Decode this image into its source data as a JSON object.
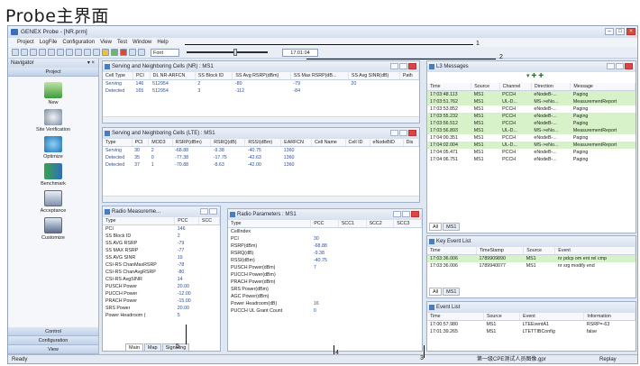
{
  "heading": "Probe主界面",
  "app": {
    "title": "GENEX Probe - [NR.prm]",
    "menu": [
      "Project",
      "LogFile",
      "Configuration",
      "View",
      "Test",
      "Window",
      "Help"
    ],
    "toolbar": {
      "font_value": "Font",
      "time_value": "17:01:04"
    }
  },
  "callouts": [
    "1",
    "2",
    "3",
    "4",
    "5"
  ],
  "navigator": {
    "title": "Navigator",
    "project_button": "Project",
    "items": [
      "New",
      "Site Verification",
      "Optimize",
      "Benchmark",
      "Acceptance",
      "Customize"
    ],
    "bottom_buttons": [
      "Control",
      "Configuration",
      "View"
    ]
  },
  "nr_cells": {
    "title": "Serving and Neighboring Cells (NR) : MS1",
    "headers": [
      "Cell Type",
      "PCI",
      "DL NR-ARFCN",
      "SS Block ID",
      "SS Avg RSRP(dBm)",
      "SS Max RSRP(dB...",
      "SS Avg SINR(dB)",
      "Path"
    ],
    "rows": [
      [
        "Serving",
        "146",
        "512954",
        "2",
        "-80",
        "-79",
        "20",
        ""
      ],
      [
        "Detected",
        "165",
        "512954",
        "3",
        "-112",
        "-84",
        "",
        ""
      ]
    ]
  },
  "lte_cells": {
    "title": "Serving and Neighboring Cells (LTE) : MS1",
    "headers": [
      "Type",
      "PCI",
      "MOD3",
      "RSRP(dBm)",
      "RSRQ(dB)",
      "RSSI(dBm)",
      "EARFCN",
      "Cell Name",
      "Cell ID",
      "eNodeBID",
      "Dis"
    ],
    "rows": [
      [
        "Serving",
        "30",
        "2",
        "-68.88",
        "-9.38",
        "-40.75",
        "1360",
        "",
        "",
        "",
        ""
      ],
      [
        "Detected",
        "35",
        "0",
        "-77.38",
        "-17.75",
        "-42.63",
        "1360",
        "",
        "",
        "",
        ""
      ],
      [
        "Detected",
        "37",
        "1",
        "-70.88",
        "-8.63",
        "-42.00",
        "1360",
        "",
        "",
        "",
        ""
      ]
    ]
  },
  "radio_measure": {
    "title": "Radio Measureme...",
    "headers": [
      "Type",
      "PCC",
      "SCC"
    ],
    "rows": [
      [
        "PCI",
        "146",
        ""
      ],
      [
        "SS Block ID",
        "2",
        ""
      ],
      [
        "SS AVG RSRP",
        "-79",
        ""
      ],
      [
        "SS MAX RSRP",
        "-77",
        ""
      ],
      [
        "SS AVG SINR",
        "19",
        ""
      ],
      [
        "CSI-RS ChanMaxRSRP",
        "-78",
        ""
      ],
      [
        "CSI-RS ChanAvgRSRP",
        "-80",
        ""
      ],
      [
        "CSI-RS AvgSINR",
        "14",
        ""
      ],
      [
        "PUSCH Power",
        "20.00",
        ""
      ],
      [
        "PUCCH Power",
        "-12.00",
        ""
      ],
      [
        "PRACH Power",
        "-15.00",
        ""
      ],
      [
        "SRS Power",
        "20.00",
        ""
      ],
      [
        "Power Headroom (",
        "5",
        ""
      ]
    ]
  },
  "radio_params": {
    "title": "Radio Parameters : MS1",
    "headers": [
      "Type",
      "PCC",
      "SCC1",
      "SCC2",
      "SCC3"
    ],
    "rows": [
      [
        "CellIndex",
        ""
      ],
      [
        "PCI",
        "30"
      ],
      [
        "RSRP(dBm)",
        "-68.88"
      ],
      [
        "RSRQ(dB)",
        "-9.38"
      ],
      [
        "RSSI(dBm)",
        "-40.75"
      ],
      [
        "PUSCH Power(dBm)",
        "7"
      ],
      [
        "PUCCH Power(dBm)",
        ""
      ],
      [
        "PRACH Power(dBm)",
        ""
      ],
      [
        "SRS Power(dBm)",
        ""
      ],
      [
        "AGC Power(dBm)",
        ""
      ],
      [
        "Power Headroom(dB)",
        "16"
      ],
      [
        "PUCCH UL Grant Count",
        "0"
      ]
    ]
  },
  "messages": {
    "title": "L3 Messages",
    "headers": [
      "Time",
      "Source",
      "Channel",
      "Direction",
      "Message"
    ],
    "rows": [
      {
        "v": [
          "17:03:48.113",
          "MS1",
          "PCCH",
          "eNodeB-...",
          "Paging"
        ],
        "hl": true
      },
      {
        "v": [
          "17:03:51.762",
          "MS1",
          "UL-D...",
          "MS->eNo...",
          "MeasurementReport"
        ],
        "hl": true
      },
      {
        "v": [
          "17:03:53.852",
          "MS1",
          "PCCH",
          "eNodeB-...",
          "Paging"
        ],
        "hl": false
      },
      {
        "v": [
          "17:03:55.232",
          "MS1",
          "PCCH",
          "eNodeB-...",
          "Paging"
        ],
        "hl": true
      },
      {
        "v": [
          "17:03:56.512",
          "MS1",
          "PCCH",
          "eNodeB-...",
          "Paging"
        ],
        "hl": true
      },
      {
        "v": [
          "17:03:56.893",
          "MS1",
          "UL-D...",
          "MS->eNo...",
          "MeasurementReport"
        ],
        "hl": true
      },
      {
        "v": [
          "17:04:00.351",
          "MS1",
          "PCCH",
          "eNodeB-...",
          "Paging"
        ],
        "hl": false
      },
      {
        "v": [
          "17:04:02.004",
          "MS1",
          "UL-D...",
          "MS->eNo...",
          "MeasurementReport"
        ],
        "hl": true
      },
      {
        "v": [
          "17:04:05.471",
          "MS1",
          "PCCH",
          "eNodeB-...",
          "Paging"
        ],
        "hl": false
      },
      {
        "v": [
          "17:04:06.751",
          "MS1",
          "PCCH",
          "eNodeB-...",
          "Paging"
        ],
        "hl": false
      }
    ],
    "tabs": [
      "All",
      "MS1"
    ]
  },
  "key_events": {
    "title": "Key Event List",
    "headers": [
      "Time",
      "TimeStamp",
      "Source",
      "Event"
    ],
    "rows": [
      [
        "17:03:36.006",
        "1789909890",
        "MS1",
        "nr pdcp om ent rel cmp"
      ],
      [
        "17:03:36.006",
        "1789940077",
        "MS1",
        "nr srg modify end"
      ]
    ],
    "tabs": [
      "All",
      "MS1"
    ]
  },
  "event_list": {
    "title": "Event List",
    "headers": [
      "Time",
      "Source",
      "Event",
      "Information"
    ],
    "rows": [
      [
        "17:00:57.980",
        "MS1",
        "LTEEventA1",
        "RSRP=-63"
      ],
      [
        "17:01:39.265",
        "MS1",
        "LTETTIBConfig",
        "false"
      ]
    ]
  },
  "bottom_tabs": [
    "Main",
    "Map",
    "Signaling"
  ],
  "status": {
    "left": "Ready",
    "right_info": "第一级CPE测试人员图像.gpr",
    "replay": "Replay"
  }
}
